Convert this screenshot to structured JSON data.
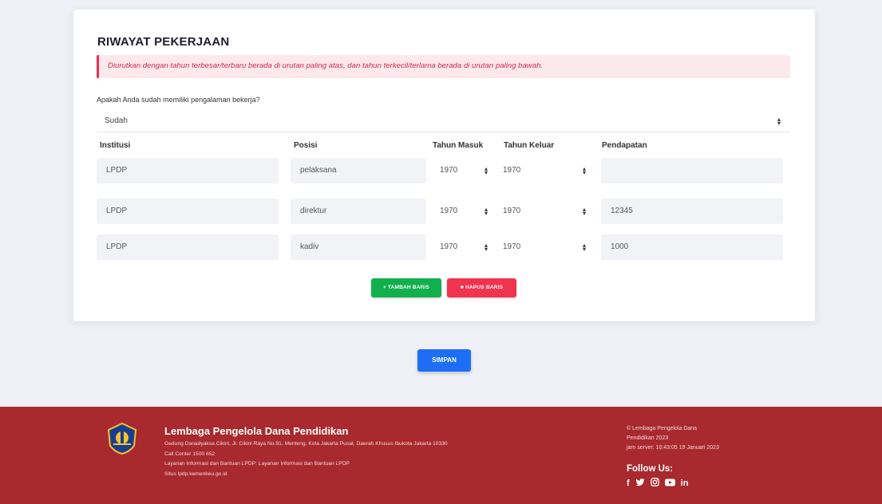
{
  "section": {
    "title": "RIWAYAT PEKERJAAN",
    "alert": "Diurutkan dengan tahun terbesar/terbaru berada di urutan paling atas, dan tahun terkecil/terlama berada di urutan paling bawah.",
    "question": "Apakah Anda sudah memiliki pengalaman bekerja?",
    "experience_value": "Sudah"
  },
  "table": {
    "headers": {
      "institusi": "Institusi",
      "posisi": "Posisi",
      "tahun_masuk": "Tahun Masuk",
      "tahun_keluar": "Tahun Keluar",
      "pendapatan": "Pendapatan"
    },
    "rows": [
      {
        "institusi": "LPDP",
        "posisi": "pelaksana",
        "tahun_masuk": "1970",
        "tahun_keluar": "1970",
        "pendapatan": ""
      },
      {
        "institusi": "LPDP",
        "posisi": "direktur",
        "tahun_masuk": "1970",
        "tahun_keluar": "1970",
        "pendapatan": "12345"
      },
      {
        "institusi": "LPDP",
        "posisi": "kadiv",
        "tahun_masuk": "1970",
        "tahun_keluar": "1970",
        "pendapatan": "1000"
      }
    ]
  },
  "buttons": {
    "add_row": "+ TAMBAH BARIS",
    "delete_row": "HAPUS BARIS",
    "save": "SIMPAN"
  },
  "footer": {
    "org": "Lembaga Pengelola Dana Pendidikan",
    "address": "Gedung Danadyaksa Cikini, Jl. Cikini Raya No.91, Menteng, Kota Jakarta Pusat, Daerah Khusus Ibukota Jakarta 10330",
    "call_center": "Call Center 1500 652",
    "info": "Layanan Informasi dan Bantuan LPDP: Layanan Informasi dan Bantuan LPDP",
    "site": "Situs lpdp.kemenkeu.go.id",
    "copyright_1": "© Lembaga Pengelola Dana",
    "copyright_2": "Pendidikan 2023",
    "server_time": "jam server: 10:43:05 19 Januari 2023",
    "follow": "Follow Us:"
  },
  "icons": {
    "sort": "sort-arrows-icon",
    "trash": "trash-icon",
    "logo": "kemenkeu-logo",
    "social": [
      "facebook-icon",
      "twitter-icon",
      "instagram-icon",
      "youtube-icon",
      "linkedin-icon"
    ]
  },
  "colors": {
    "alert": "#e8304f",
    "add": "#12b04d",
    "delete": "#f0344f",
    "save": "#1d6ef5",
    "footer": "#a8292e"
  }
}
